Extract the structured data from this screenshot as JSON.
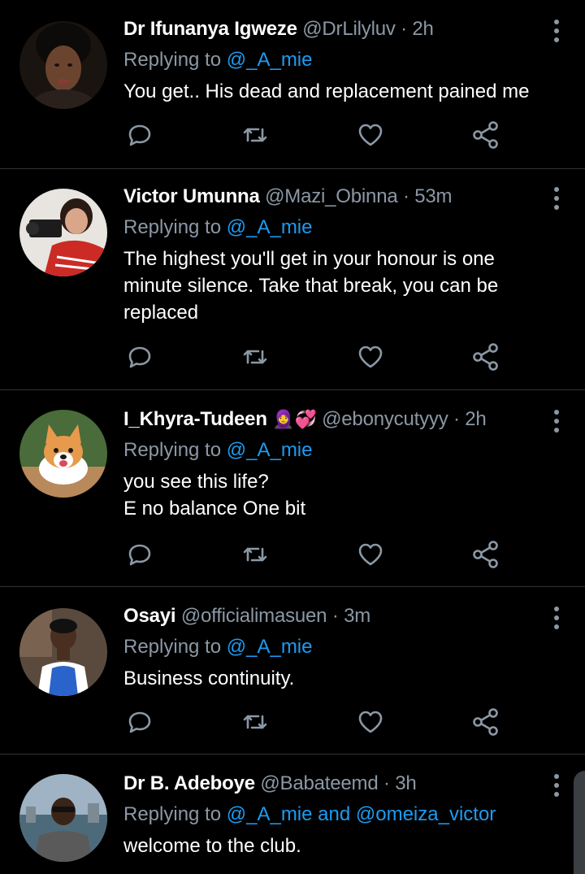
{
  "feed": {
    "tweets": [
      {
        "name": "Dr Ifunanya Igweze",
        "handle": "@DrLilyluv",
        "separator": "·",
        "time": "2h",
        "emoji": "",
        "replying_label": "Replying to",
        "mentions": "@_A_mie",
        "body": [
          "You get.. His dead and replacement pained me"
        ]
      },
      {
        "name": "Victor Umunna",
        "handle": "@Mazi_Obinna",
        "separator": "·",
        "time": "53m",
        "emoji": "",
        "replying_label": "Replying to",
        "mentions": "@_A_mie",
        "body": [
          "The highest you'll get in your honour is one",
          "minute silence. Take that break, you can be",
          "replaced"
        ]
      },
      {
        "name": "I_Khyra-Tudeen",
        "handle": "@ebonycutyyy",
        "separator": "·",
        "time": "2h",
        "emoji": "🧕💞",
        "replying_label": "Replying to",
        "mentions": "@_A_mie",
        "body": [
          "you see this life?",
          "E no balance One bit"
        ]
      },
      {
        "name": "Osayi",
        "handle": "@officialimasuen",
        "separator": "·",
        "time": "3m",
        "emoji": "",
        "replying_label": "Replying to",
        "mentions": "@_A_mie",
        "body": [
          "Business continuity."
        ]
      },
      {
        "name": "Dr B. Adeboye",
        "handle": "@Babateemd",
        "separator": "·",
        "time": "3h",
        "emoji": "",
        "replying_label": "Replying to",
        "mentions": "@_A_mie and @omeiza_victor",
        "body": [
          "welcome to the club."
        ]
      }
    ],
    "action_icons": [
      "reply-icon",
      "retweet-icon",
      "like-icon",
      "share-icon"
    ]
  },
  "colors": {
    "background": "#000000",
    "name": "#ffffff",
    "muted": "#8b98a5",
    "mention": "#1d9bf0",
    "divider": "#2f3336"
  }
}
